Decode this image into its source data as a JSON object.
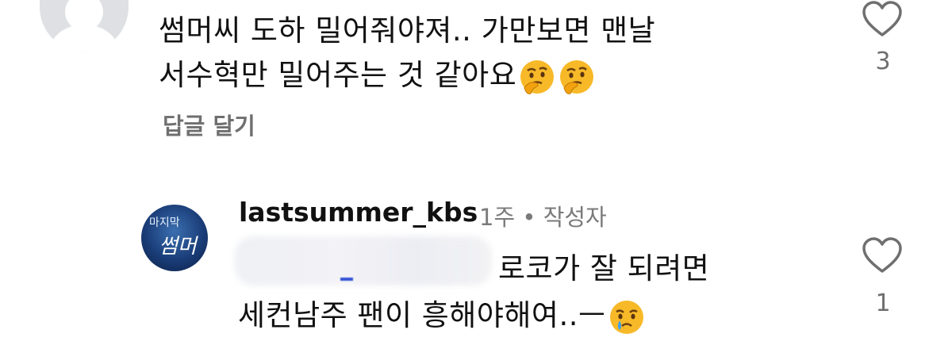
{
  "comments": [
    {
      "text_line1": "썸머씨 도하 밀어줘야져.. 가만보면 맨날",
      "text_line2": "서수혁만 밀어주는 것 같아요",
      "emojis": [
        "thinking-face-emoji",
        "thinking-face-emoji"
      ],
      "reply_label": "답글 달기",
      "like_count": "3"
    },
    {
      "username": "lastsummer_kbs",
      "time": "1주",
      "separator": "•",
      "author_badge": "작성자",
      "avatar_line1": "마지막",
      "avatar_line2": "썸머",
      "text_line1": "로코가 잘 되려면",
      "text_line2": "세컨남주 팬이 흥해야해여..ㅡ",
      "emoji": "crying-face-emoji",
      "like_count": "1"
    }
  ],
  "colors": {
    "text": "#111111",
    "secondary": "#6f6f6f",
    "avatar_placeholder": "#dfe0e3",
    "emoji_yellow": "#f7b928"
  }
}
